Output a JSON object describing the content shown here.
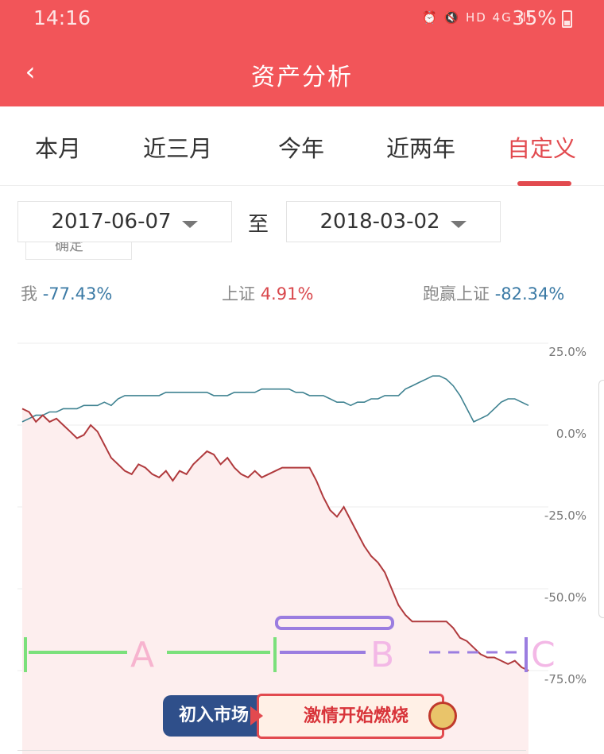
{
  "status_bar": {
    "time": "14:16",
    "indicators": "⏰ 🔇 HD 4G ıll",
    "battery": "35%"
  },
  "nav": {
    "back_icon": "chevron-left-icon",
    "title": "资产分析"
  },
  "tabs": [
    {
      "label": "本月",
      "active": false
    },
    {
      "label": "近三月",
      "active": false
    },
    {
      "label": "今年",
      "active": false
    },
    {
      "label": "近两年",
      "active": false
    },
    {
      "label": "自定义",
      "active": true
    }
  ],
  "date_range": {
    "start": "2017-06-07",
    "separator": "至",
    "end": "2018-03-02",
    "partial_label": "确定"
  },
  "summary": {
    "me_label": "我",
    "me_value": "-77.43%",
    "index_label": "上证",
    "index_value": "4.91%",
    "beat_label": "跑赢上证",
    "beat_value": "-82.34%"
  },
  "colors": {
    "brand_red": "#f25559",
    "me_line": "#b03a3d",
    "index_line": "#3f8291",
    "fill": "#fdeeee",
    "annotation_green": "#7be07b",
    "annotation_purple": "#9b7de0"
  },
  "chart_data": {
    "type": "line",
    "yticks": [
      "25.0%",
      "0.0%",
      "-25.0%",
      "-50.0%",
      "-75.0%"
    ],
    "ylim": [
      -75,
      25
    ],
    "series": [
      {
        "name": "我",
        "values": [
          5,
          4,
          1,
          3,
          1,
          2,
          0,
          -2,
          -4,
          -3,
          0,
          -2,
          -6,
          -10,
          -12,
          -14,
          -15,
          -12,
          -13,
          -15,
          -16,
          -14,
          -17,
          -14,
          -15,
          -12,
          -10,
          -8,
          -9,
          -12,
          -10,
          -13,
          -15,
          -16,
          -14,
          -16,
          -15,
          -14,
          -13,
          -13,
          -13,
          -13,
          -13,
          -17,
          -22,
          -26,
          -28,
          -25,
          -29,
          -33,
          -37,
          -40,
          -42,
          -45,
          -50,
          -55,
          -58,
          -60,
          -60,
          -60,
          -60,
          -60,
          -60,
          -62,
          -65,
          -66,
          -68,
          -70,
          -71,
          -71,
          -72,
          -73,
          -72,
          -74,
          -75
        ]
      },
      {
        "name": "上证",
        "values": [
          1,
          2,
          3,
          3,
          4,
          4,
          5,
          5,
          5,
          6,
          6,
          6,
          7,
          6,
          8,
          9,
          9,
          9,
          9,
          9,
          9,
          10,
          10,
          10,
          10,
          10,
          10,
          10,
          9,
          9,
          9,
          10,
          10,
          10,
          10,
          11,
          11,
          11,
          11,
          11,
          10,
          10,
          9,
          9,
          9,
          8,
          7,
          7,
          6,
          7,
          7,
          8,
          8,
          9,
          9,
          9,
          11,
          12,
          13,
          14,
          15,
          15,
          14,
          12,
          9,
          5,
          1,
          2,
          3,
          5,
          7,
          8,
          8,
          7,
          6
        ]
      }
    ],
    "annotations": [
      {
        "label": "A"
      },
      {
        "label": "B"
      },
      {
        "label": "C"
      }
    ]
  },
  "banner": {
    "left_text": "初入市场",
    "right_text": "激情开始燃烧"
  }
}
